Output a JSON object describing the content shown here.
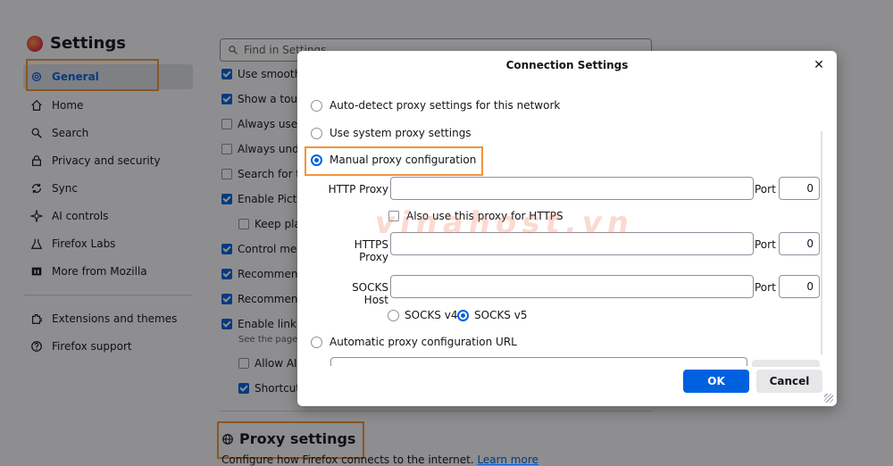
{
  "settings": {
    "title": "Settings",
    "search_placeholder": "Find in Settings",
    "nav": [
      {
        "label": "General",
        "icon": "gear-icon"
      },
      {
        "label": "Home",
        "icon": "home-icon"
      },
      {
        "label": "Search",
        "icon": "search-icon"
      },
      {
        "label": "Privacy and security",
        "icon": "lock-icon"
      },
      {
        "label": "Sync",
        "icon": "sync-icon"
      },
      {
        "label": "AI controls",
        "icon": "sparkle-icon"
      },
      {
        "label": "Firefox Labs",
        "icon": "flask-icon"
      },
      {
        "label": "More from Mozilla",
        "icon": "mozilla-icon"
      }
    ],
    "nav_bottom": [
      {
        "label": "Extensions and themes",
        "icon": "puzzle-icon"
      },
      {
        "label": "Firefox support",
        "icon": "help-icon"
      }
    ],
    "options": [
      {
        "label": "Use smooth",
        "checked": true
      },
      {
        "label": "Show a touc",
        "checked": true
      },
      {
        "label": "Always use t",
        "checked": false
      },
      {
        "label": "Always unde",
        "checked": false
      },
      {
        "label": "Search for te",
        "checked": false
      },
      {
        "label": "Enable Pictu",
        "checked": true
      },
      {
        "label": "Keep pla",
        "checked": false
      },
      {
        "label": "Control med",
        "checked": true
      },
      {
        "label": "Recommend",
        "checked": true
      },
      {
        "label": "Recommend",
        "checked": true
      },
      {
        "label": "Enable link p",
        "checked": true
      },
      {
        "label": "Allow AI",
        "checked": false
      },
      {
        "label": "Shortcut:",
        "checked": true
      }
    ],
    "note": "See the page t",
    "proxy_title": "Proxy settings",
    "proxy_desc": "Configure how Firefox connects to the internet.",
    "learn_more": "Learn more"
  },
  "dialog": {
    "title": "Connection Settings",
    "options": {
      "auto_detect": "Auto-detect proxy settings for this network",
      "system": "Use system proxy settings",
      "manual": "Manual proxy configuration",
      "auto_url": "Automatic proxy configuration URL"
    },
    "http_label": "HTTP Proxy",
    "https_label": "HTTPS Proxy",
    "socks_label": "SOCKS Host",
    "port_label": "Port",
    "http_port": "0",
    "https_port": "0",
    "socks_port": "0",
    "also_use": "Also use this proxy for HTTPS",
    "socks_v4": "SOCKS v4",
    "socks_v5": "SOCKS v5",
    "ok": "OK",
    "cancel": "Cancel"
  },
  "watermark": "vinahost.vn",
  "colors": {
    "accent": "#0061e0",
    "highlight": "#f0943a"
  }
}
